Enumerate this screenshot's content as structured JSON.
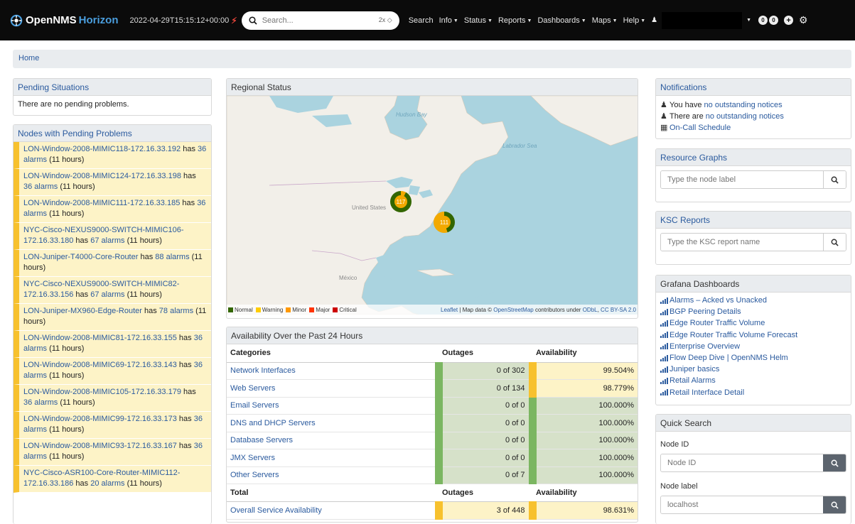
{
  "navbar": {
    "brand_main": "OpenNMS",
    "brand_sub": "Horizon",
    "timestamp": "2022-04-29T15:15:12+00:00",
    "search_placeholder": "Search...",
    "search_shortcut": "2x ◇",
    "menu": [
      {
        "label": "Search",
        "caret": false
      },
      {
        "label": "Info",
        "caret": true
      },
      {
        "label": "Status",
        "caret": true
      },
      {
        "label": "Reports",
        "caret": true
      },
      {
        "label": "Dashboards",
        "caret": true
      },
      {
        "label": "Maps",
        "caret": true
      },
      {
        "label": "Help",
        "caret": true
      }
    ],
    "badge_1": "0",
    "badge_2": "0"
  },
  "breadcrumb": {
    "home": "Home"
  },
  "pending_situations": {
    "title": "Pending Situations",
    "message": "There are no pending problems."
  },
  "nodes_pending": {
    "title": "Nodes with Pending Problems",
    "items": [
      {
        "node": "LON-Window-2008-MIMIC118-172.16.33.192",
        "count": "36 alarms",
        "age": "(11 hours)"
      },
      {
        "node": "LON-Window-2008-MIMIC124-172.16.33.198",
        "count": "36 alarms",
        "age": "(11 hours)"
      },
      {
        "node": "LON-Window-2008-MIMIC111-172.16.33.185",
        "count": "36 alarms",
        "age": "(11 hours)"
      },
      {
        "node": "NYC-Cisco-NEXUS9000-SWITCH-MIMIC106-172.16.33.180",
        "count": "67 alarms",
        "age": "(11 hours)"
      },
      {
        "node": "LON-Juniper-T4000-Core-Router",
        "count": "88 alarms",
        "age": "(11 hours)"
      },
      {
        "node": "NYC-Cisco-NEXUS9000-SWITCH-MIMIC82-172.16.33.156",
        "count": "67 alarms",
        "age": "(11 hours)"
      },
      {
        "node": "LON-Juniper-MX960-Edge-Router",
        "count": "78 alarms",
        "age": "(11 hours)"
      },
      {
        "node": "LON-Window-2008-MIMIC81-172.16.33.155",
        "count": "36 alarms",
        "age": "(11 hours)"
      },
      {
        "node": "LON-Window-2008-MIMIC69-172.16.33.143",
        "count": "36 alarms",
        "age": "(11 hours)"
      },
      {
        "node": "LON-Window-2008-MIMIC105-172.16.33.179",
        "count": "36 alarms",
        "age": "(11 hours)"
      },
      {
        "node": "LON-Window-2008-MIMIC99-172.16.33.173",
        "count": "36 alarms",
        "age": "(11 hours)"
      },
      {
        "node": "LON-Window-2008-MIMIC93-172.16.33.167",
        "count": "36 alarms",
        "age": "(11 hours)"
      },
      {
        "node": "NYC-Cisco-ASR100-Core-Router-MIMIC112-172.16.33.186",
        "count": "20 alarms",
        "age": "(11 hours)"
      }
    ],
    "has_text": "has"
  },
  "regional_status": {
    "title": "Regional Status",
    "labels": {
      "hudson": "Hudson Bay",
      "labrador": "Labrador Sea",
      "us": "United States",
      "mexico": "México"
    },
    "clusters": [
      "117",
      "111"
    ],
    "legend": [
      {
        "label": "Normal",
        "color": "#336600"
      },
      {
        "label": "Warning",
        "color": "#ffcc00"
      },
      {
        "label": "Minor",
        "color": "#ff9900"
      },
      {
        "label": "Major",
        "color": "#ff3300"
      },
      {
        "label": "Critical",
        "color": "#cc0000"
      }
    ],
    "attrib_leaflet": "Leaflet",
    "attrib_mapdata": " | Map data © ",
    "attrib_osm": "OpenStreetMap",
    "attrib_under": " contributors under ",
    "attrib_odbl": "ODbL",
    "attrib_comma": ", ",
    "attrib_cc": "CC BY-SA 2.0"
  },
  "availability": {
    "title": "Availability Over the Past 24 Hours",
    "headers": {
      "categories": "Categories",
      "outages": "Outages",
      "availability": "Availability"
    },
    "rows": [
      {
        "category": "Network Interfaces",
        "outages": "0 of 302",
        "availability": "99.504%",
        "out_status": "green",
        "av_status": "yellow"
      },
      {
        "category": "Web Servers",
        "outages": "0 of 134",
        "availability": "98.779%",
        "out_status": "green",
        "av_status": "yellow"
      },
      {
        "category": "Email Servers",
        "outages": "0 of 0",
        "availability": "100.000%",
        "out_status": "green",
        "av_status": "green"
      },
      {
        "category": "DNS and DHCP Servers",
        "outages": "0 of 0",
        "availability": "100.000%",
        "out_status": "green",
        "av_status": "green"
      },
      {
        "category": "Database Servers",
        "outages": "0 of 0",
        "availability": "100.000%",
        "out_status": "green",
        "av_status": "green"
      },
      {
        "category": "JMX Servers",
        "outages": "0 of 0",
        "availability": "100.000%",
        "out_status": "green",
        "av_status": "green"
      },
      {
        "category": "Other Servers",
        "outages": "0 of 7",
        "availability": "100.000%",
        "out_status": "green",
        "av_status": "green"
      }
    ],
    "total_headers": {
      "total": "Total",
      "outages": "Outages",
      "availability": "Availability"
    },
    "overall": {
      "category": "Overall Service Availability",
      "outages": "3 of 448",
      "availability": "98.631%",
      "out_status": "yellow",
      "av_status": "yellow"
    }
  },
  "notifications": {
    "title": "Notifications",
    "line1_prefix": "You have ",
    "line1_link": "no outstanding notices",
    "line2_prefix": "There are ",
    "line2_link": "no outstanding notices",
    "oncall": "On-Call Schedule"
  },
  "resource_graphs": {
    "title": "Resource Graphs",
    "placeholder": "Type the node label"
  },
  "ksc_reports": {
    "title": "KSC Reports",
    "placeholder": "Type the KSC report name"
  },
  "grafana": {
    "title": "Grafana Dashboards",
    "items": [
      "Alarms – Acked vs Unacked",
      "BGP Peering Details",
      "Edge Router Traffic Volume",
      "Edge Router Traffic Volume Forecast",
      "Enterprise Overview",
      "Flow Deep Dive | OpenNMS Helm",
      "Juniper basics",
      "Retail Alarms",
      "Retail Interface Detail"
    ]
  },
  "quick_search": {
    "title": "Quick Search",
    "node_id_label": "Node ID",
    "node_id_placeholder": "Node ID",
    "node_label_label": "Node label",
    "node_label_placeholder": "localhost"
  }
}
